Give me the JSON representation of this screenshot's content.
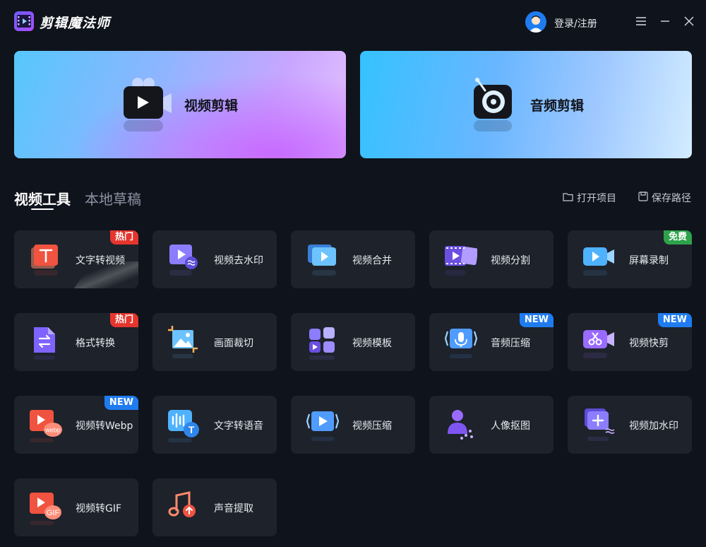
{
  "app": {
    "title": "剪辑魔法师",
    "login_label": "登录/注册"
  },
  "hero": {
    "video_label": "视频剪辑",
    "audio_label": "音频剪辑"
  },
  "tabs": [
    {
      "label": "视频工具",
      "active": true
    },
    {
      "label": "本地草稿",
      "active": false
    }
  ],
  "actions": {
    "open_project": "打开项目",
    "save_path": "保存路径"
  },
  "tools": [
    {
      "label": "文字转视频",
      "badge": "热门",
      "badge_type": "hot",
      "icon": "text-to-video-icon"
    },
    {
      "label": "视频去水印",
      "badge": "",
      "badge_type": "",
      "icon": "remove-watermark-icon"
    },
    {
      "label": "视频合并",
      "badge": "",
      "badge_type": "",
      "icon": "merge-video-icon"
    },
    {
      "label": "视频分割",
      "badge": "",
      "badge_type": "",
      "icon": "split-video-icon"
    },
    {
      "label": "屏幕录制",
      "badge": "免费",
      "badge_type": "free",
      "icon": "screen-record-icon"
    },
    {
      "label": "格式转换",
      "badge": "热门",
      "badge_type": "hot",
      "icon": "format-convert-icon"
    },
    {
      "label": "画面裁切",
      "badge": "",
      "badge_type": "",
      "icon": "crop-icon"
    },
    {
      "label": "视频模板",
      "badge": "",
      "badge_type": "",
      "icon": "template-icon"
    },
    {
      "label": "音频压缩",
      "badge": "NEW",
      "badge_type": "new",
      "icon": "audio-compress-icon"
    },
    {
      "label": "视频快剪",
      "badge": "NEW",
      "badge_type": "new",
      "icon": "quick-cut-icon"
    },
    {
      "label": "视频转Webp",
      "badge": "NEW",
      "badge_type": "new",
      "icon": "video-to-webp-icon"
    },
    {
      "label": "文字转语音",
      "badge": "",
      "badge_type": "",
      "icon": "text-to-speech-icon"
    },
    {
      "label": "视频压缩",
      "badge": "",
      "badge_type": "",
      "icon": "video-compress-icon"
    },
    {
      "label": "人像抠图",
      "badge": "",
      "badge_type": "",
      "icon": "portrait-cutout-icon"
    },
    {
      "label": "视频加水印",
      "badge": "",
      "badge_type": "",
      "icon": "add-watermark-icon"
    },
    {
      "label": "视频转GIF",
      "badge": "",
      "badge_type": "",
      "icon": "video-to-gif-icon"
    },
    {
      "label": "声音提取",
      "badge": "",
      "badge_type": "",
      "icon": "audio-extract-icon"
    }
  ],
  "icon_text": {
    "webp": "webp",
    "gif": "GIF",
    "text_t": "T"
  },
  "colors": {
    "hot": "#e5352d",
    "free": "#2ea24a",
    "new": "#1f7cf0",
    "card": "#1e222b",
    "background": "#0f131b"
  }
}
